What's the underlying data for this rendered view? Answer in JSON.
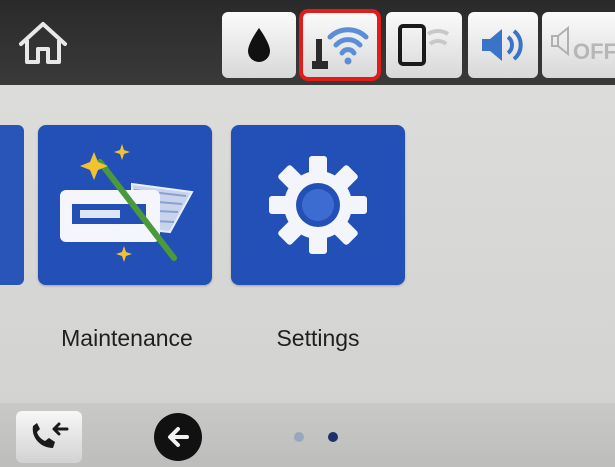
{
  "status_bar": {
    "icons": [
      "home-icon",
      "ink-drop-icon",
      "wifi-icon",
      "wifi-direct-icon",
      "sound-icon",
      "quiet-mode-icon"
    ],
    "quiet_label": "OFF",
    "highlight_color": "#e21b1b"
  },
  "menu": {
    "tiles": [
      {
        "label": "Maintenance",
        "icon": "maintenance-icon"
      },
      {
        "label": "Settings",
        "icon": "gear-icon"
      }
    ],
    "tile_color": "#2350b6"
  },
  "bottom_bar": {
    "icons": [
      "call-icon",
      "back-arrow-icon"
    ],
    "page_indicator": {
      "count": 2,
      "active": 2
    }
  }
}
